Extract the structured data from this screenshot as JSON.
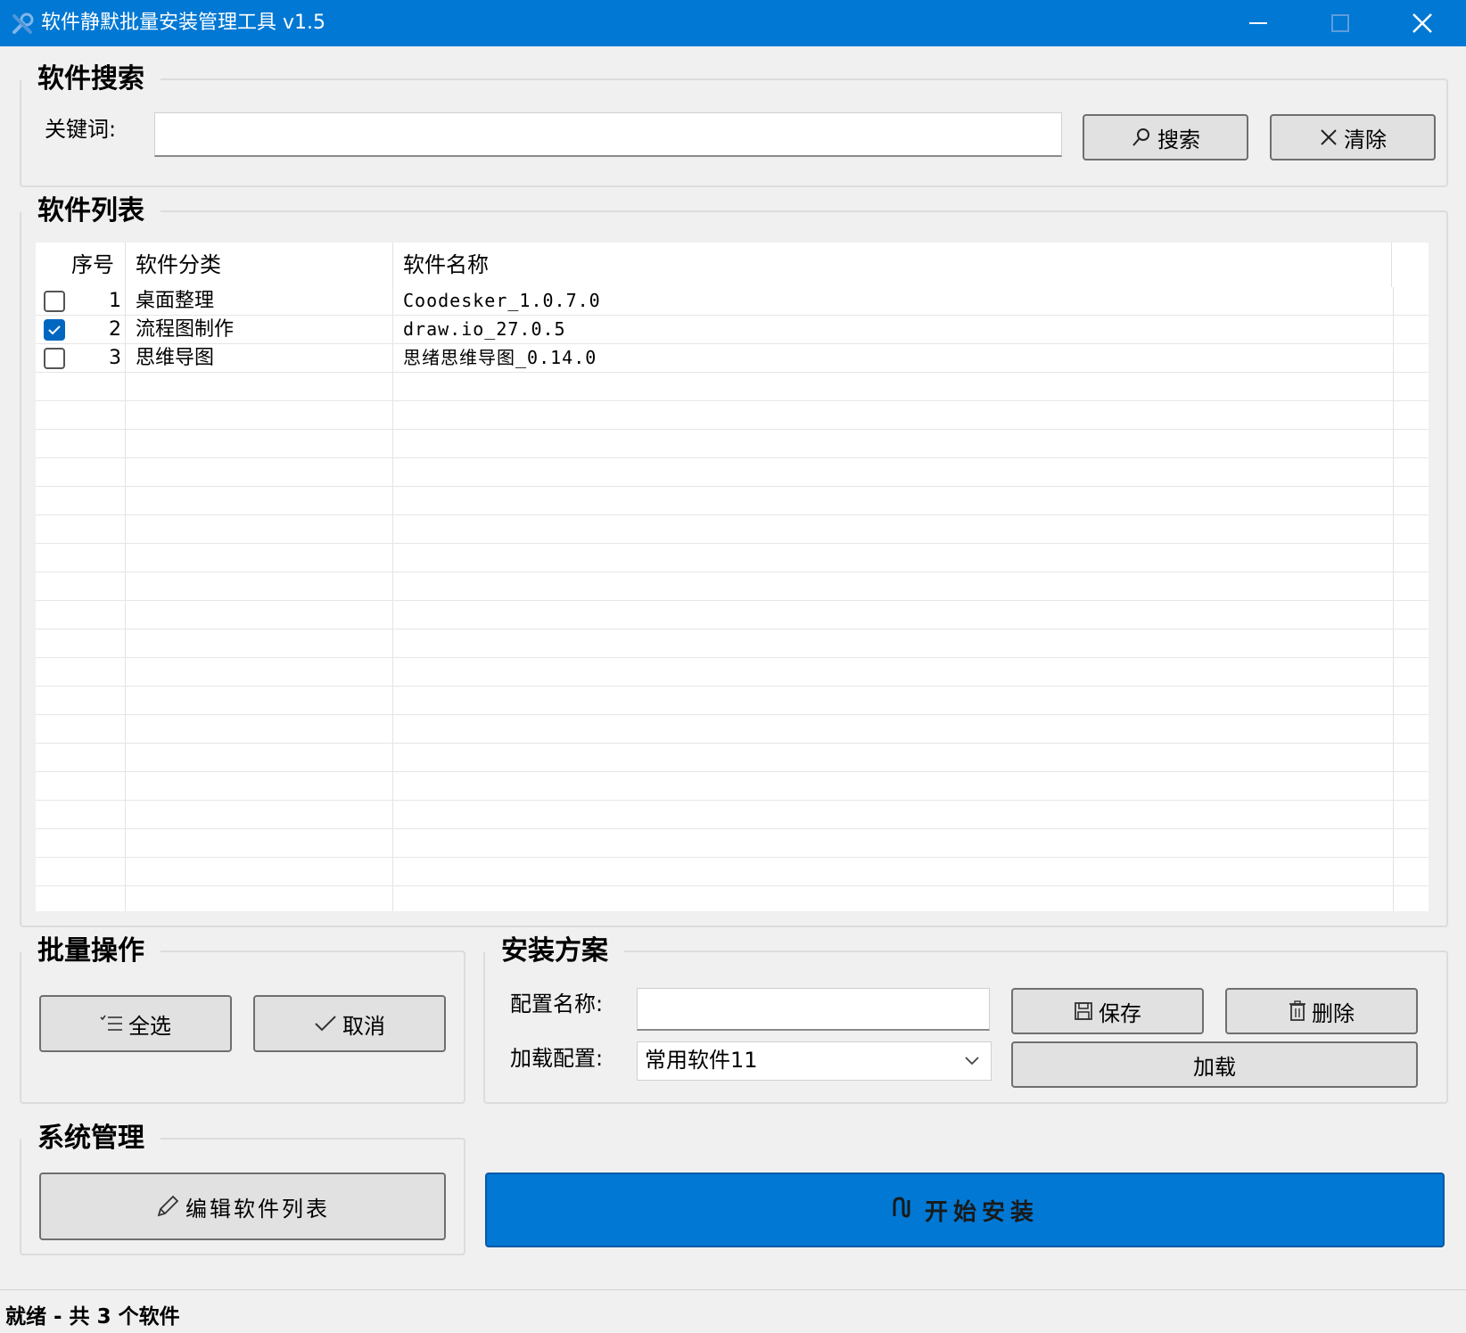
{
  "window": {
    "title": "软件静默批量安装管理工具 v1.5",
    "accent": "#0078d4"
  },
  "search_group": {
    "legend": "软件搜索",
    "keyword_label": "关键词:",
    "keyword_value": "",
    "search_label": "搜索",
    "clear_label": "清除"
  },
  "list_group": {
    "legend": "软件列表",
    "columns": [
      "序号",
      "软件分类",
      "软件名称"
    ],
    "rows": [
      {
        "checked": false,
        "index": "1",
        "category": "桌面整理",
        "name": "Coodesker_1.0.7.0"
      },
      {
        "checked": true,
        "index": "2",
        "category": "流程图制作",
        "name": "draw.io_27.0.5"
      },
      {
        "checked": false,
        "index": "3",
        "category": "思维导图",
        "name": "思绪思维导图_0.14.0"
      }
    ]
  },
  "batch_group": {
    "legend": "批量操作",
    "select_all_label": "全选",
    "cancel_label": "取消"
  },
  "plan_group": {
    "legend": "安装方案",
    "config_name_label": "配置名称:",
    "config_name_value": "",
    "save_label": "保存",
    "delete_label": "删除",
    "load_config_label": "加载配置:",
    "load_config_value": "常用软件11",
    "load_label": "加载"
  },
  "system_group": {
    "legend": "系统管理",
    "edit_list_label": "编辑软件列表"
  },
  "start_install_label": "开始安装",
  "status": {
    "text": "就绪 - 共 3 个软件"
  }
}
